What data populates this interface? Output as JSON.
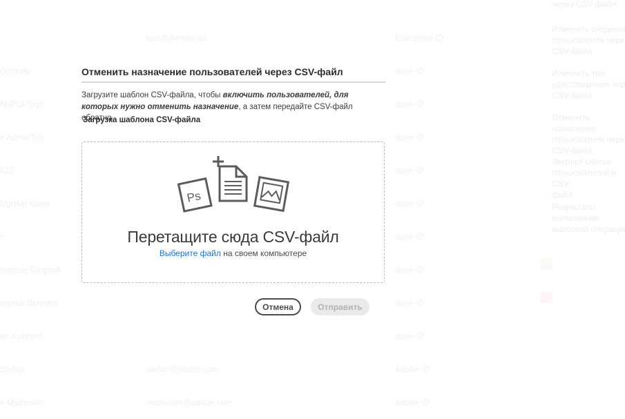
{
  "background": {
    "rows": [
      {
        "name": "",
        "email": "",
        "type": ""
      },
      {
        "name": "",
        "email": "test@domain.us",
        "type": "Enterprise ID"
      },
      {
        "name": "connolly",
        "email": "",
        "type": "dooe ID"
      },
      {
        "name": "NoPDFSign",
        "email": "",
        "type": "dooe ID"
      },
      {
        "name": "e AdminTab",
        "email": "",
        "type": "dooe ID"
      },
      {
        "name": "822",
        "email": "",
        "type": "dooe ID"
      },
      {
        "name": "Dgroup stage",
        "email": "",
        "type": "dooe ID"
      },
      {
        "name": "n",
        "email": "",
        "type": "dooe ID"
      },
      {
        "name": "terprise Gingsoft",
        "email": "",
        "type": "dooe ID"
      },
      {
        "name": "omeus Bonsaro",
        "email": "",
        "type": "dooe ID"
      },
      {
        "name": "on Kuehpel",
        "email": "",
        "type": "dooe ID"
      },
      {
        "name": "Stefan",
        "email": "stefan@adobe.com",
        "type": "Adobe ID"
      },
      {
        "name": "e Matheson",
        "email": "matheson@adobe.com",
        "type": "Adobe ID"
      }
    ],
    "sidebar_items": [
      "через CSV-файл",
      "Изменить сведения\nпользователя через\nCSV-файл",
      "Изменить тип\nудостоверения через\nCSV-файл",
      "Отменить назначение\nпользователя через\nCSV-файл",
      "Экспорт списка\nпользователей в CSV-\nфайл",
      "Результаты выполнения\nмассовой операции"
    ],
    "colors": {
      "badge_green": "#cfe3c4",
      "badge_red": "#f0c4c4"
    }
  },
  "dialog": {
    "title": "Отменить назначение пользователей через CSV-файл",
    "desc_part1": "Загрузите шаблон CSV-файла, чтобы ",
    "desc_emphasis": "включить пользователей, для которых нужно отменить назначение",
    "desc_part2": ", а затем передайте CSV-файл обратно.",
    "download_template_label": "Загрузка шаблона CSV-файла",
    "dropzone": {
      "title": "Перетащите сюда CSV-файл",
      "choose_link": "Выберите файл",
      "choose_suffix": " на своем компьютере",
      "icons": [
        "photoshop-file-icon",
        "new-document-icon",
        "image-file-icon"
      ],
      "ps_label": "Ps"
    },
    "buttons": {
      "cancel": "Отмена",
      "submit": "Отправить"
    },
    "colors": {
      "link": "#1473e6",
      "title_rule": "#d8d8d8",
      "disabled_button": "#eaeaea"
    }
  }
}
